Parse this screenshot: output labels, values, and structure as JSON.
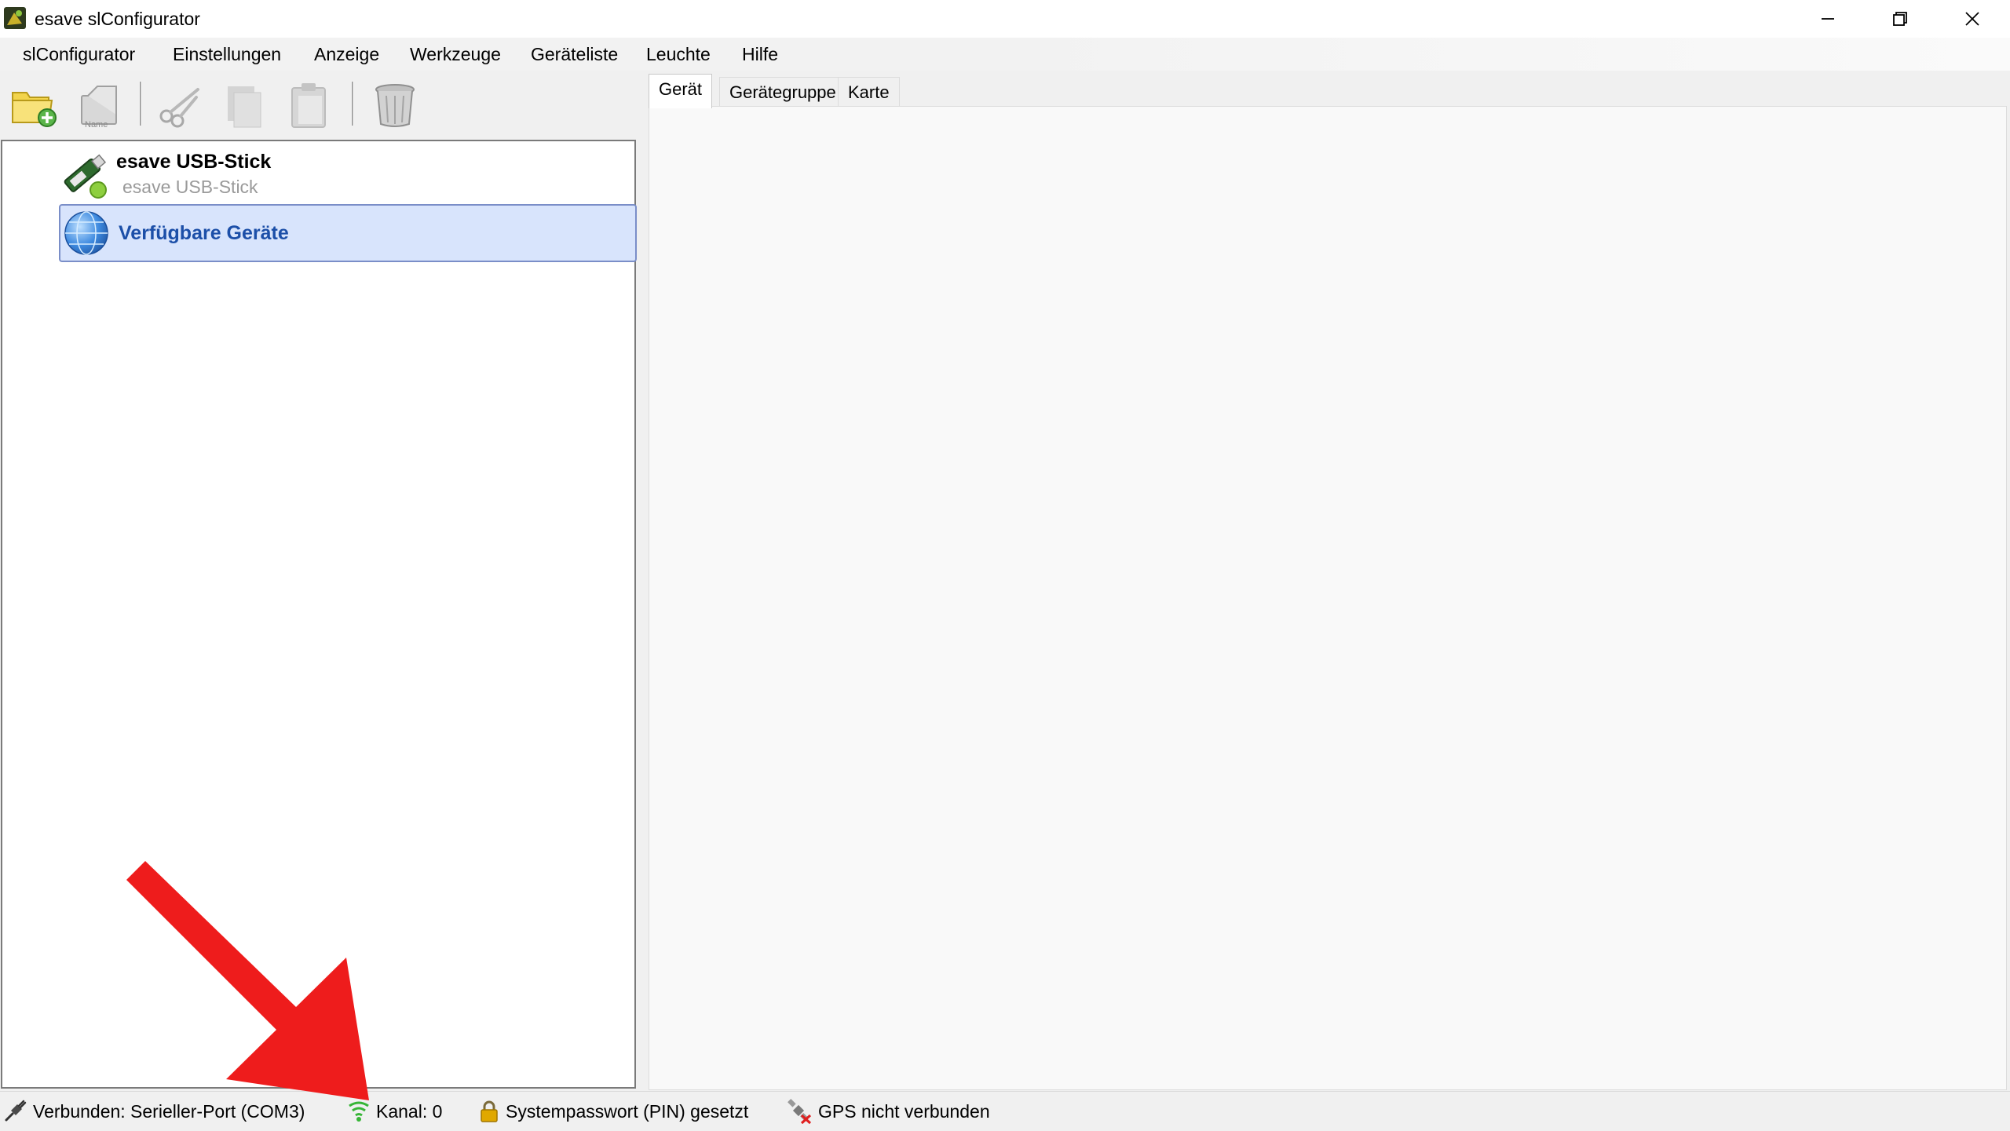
{
  "window": {
    "title": "esave slConfigurator",
    "controls": {
      "minimize": "minimize-icon",
      "restore": "restore-icon",
      "close": "close-icon"
    }
  },
  "menu": {
    "items": [
      "slConfigurator",
      "Einstellungen",
      "Anzeige",
      "Werkzeuge",
      "Geräteliste",
      "Leuchte",
      "Hilfe"
    ]
  },
  "toolbar": {
    "buttons": [
      {
        "icon": "new-folder-icon"
      },
      {
        "icon": "rename-icon",
        "caption": "Name"
      },
      {
        "icon": "cut-icon"
      },
      {
        "icon": "copy-icon"
      },
      {
        "icon": "paste-icon"
      },
      {
        "icon": "trash-icon"
      }
    ]
  },
  "tree": {
    "usb": {
      "title": "esave USB-Stick",
      "subtitle": "esave USB-Stick",
      "icon": "usb-stick-icon"
    },
    "devices": {
      "label": "Verfügbare Geräte",
      "icon": "globe-icon",
      "selected": true
    }
  },
  "tabs": [
    {
      "label": "Gerät",
      "active": true
    },
    {
      "label": "Gerätegruppe",
      "active": false
    },
    {
      "label": "Karte",
      "active": false
    }
  ],
  "status": {
    "connection": {
      "text": "Verbunden: Serieller-Port (COM3)",
      "icon": "plug-icon"
    },
    "channel": {
      "text": "Kanal: 0",
      "icon": "signal-icon"
    },
    "pin": {
      "text": "Systempasswort (PIN) gesetzt",
      "icon": "lock-icon"
    },
    "gps": {
      "text": "GPS nicht verbunden",
      "icon": "satellite-disconnected-icon"
    }
  },
  "colors": {
    "selection_bg": "#d8e4fc",
    "selection_text": "#1c4fa8",
    "annotation_arrow": "#ee1c1c",
    "signal_green": "#36b536",
    "lock_gold": "#e0a800"
  }
}
